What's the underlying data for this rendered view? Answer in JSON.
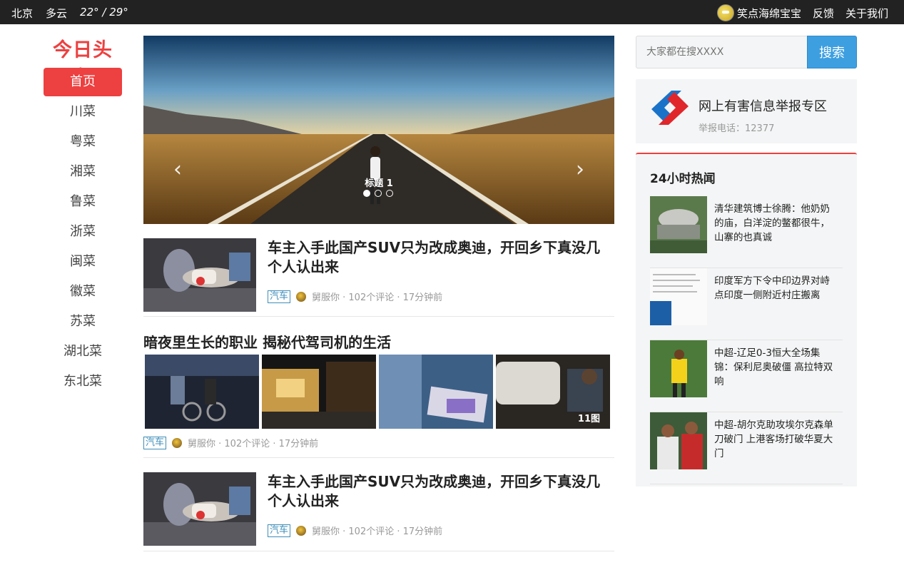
{
  "topbar": {
    "city": "北京",
    "weather": "多云",
    "temp": "22° / 29°",
    "user": "笑点海绵宝宝",
    "feedback": "反馈",
    "about": "关于我们"
  },
  "logo": "今日头条",
  "nav": [
    "首页",
    "川菜",
    "粤菜",
    "湘菜",
    "鲁菜",
    "浙菜",
    "闽菜",
    "徽菜",
    "苏菜",
    "湖北菜",
    "东北菜"
  ],
  "carousel": {
    "caption": "标题 1",
    "slide_count": 3,
    "active_slide": 1
  },
  "feed": [
    {
      "title": "车主入手此国产SUV只为改成奥迪，开回乡下真没几个人认出来",
      "tag": "汽车",
      "meta": "舅服你 · 102个评论 · 17分钟前"
    },
    {
      "title": "车主入手此国产SUV只为改成奥迪，开回乡下真没几个人认出来",
      "tag": "汽车",
      "meta": "舅服你 · 102个评论 · 17分钟前"
    }
  ],
  "gallery": {
    "title": "暗夜里生长的职业 揭秘代驾司机的生活",
    "count": "11图",
    "tag": "汽车",
    "meta": "舅服你 · 102个评论 · 17分钟前"
  },
  "search": {
    "placeholder": "大家都在搜XXXX",
    "button": "搜索"
  },
  "report": {
    "title": "网上有害信息举报专区",
    "phone": "举报电话：12377"
  },
  "hot": {
    "heading": "24小时热闻",
    "items": [
      "清华建筑博士徐腾：他奶奶的庙，白洋淀的鳖都很牛，山寨的也真诚",
      "印度军方下令中印边界对峙点印度一侧附近村庄搬离",
      "中超-辽足0-3恒大全场集锦：保利尼奥破僵 高拉特双响",
      "中超-胡尔克助攻埃尔克森单刀破门 上港客场打破华夏大门"
    ]
  },
  "colors": {
    "brand_red": "#ed4040",
    "search_blue": "#3d9fe0",
    "tag_blue": "#3e8eb8",
    "topbar": "#222222"
  }
}
